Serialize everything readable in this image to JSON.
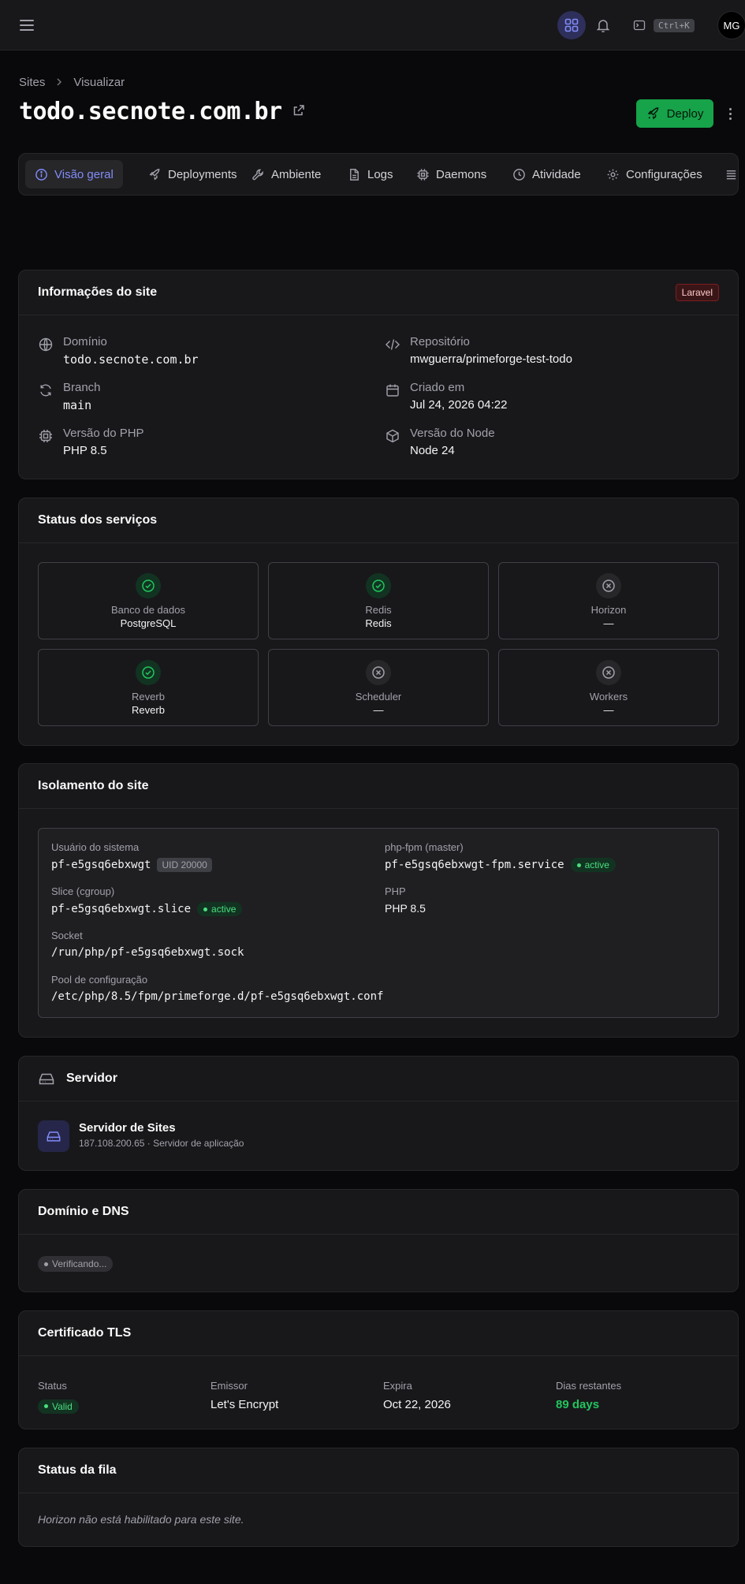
{
  "topbar": {
    "shortcut": "Ctrl+K",
    "avatar_initials": "MG",
    "accent": "#818cf8"
  },
  "breadcrumb": {
    "root": "Sites",
    "current": "Visualizar"
  },
  "page": {
    "title": "todo.secnote.com.br",
    "deploy_label": "Deploy"
  },
  "tabs": [
    {
      "label": "Visão geral",
      "icon": "info-icon",
      "active": true
    },
    {
      "label": "Deployments",
      "icon": "rocket-icon"
    },
    {
      "label": "Ambiente",
      "icon": "wrench-icon"
    },
    {
      "label": "Logs",
      "icon": "file-icon"
    },
    {
      "label": "Daemons",
      "icon": "cpu-icon"
    },
    {
      "label": "Atividade",
      "icon": "clock-icon"
    },
    {
      "label": "Configurações",
      "icon": "gear-icon"
    }
  ],
  "site_info": {
    "title": "Informações do site",
    "framework_badge": "Laravel",
    "domain_label": "Domínio",
    "domain": "todo.secnote.com.br",
    "repo_label": "Repositório",
    "repo": "mwguerra/primeforge-test-todo",
    "branch_label": "Branch",
    "branch": "main",
    "created_label": "Criado em",
    "created": "Jul 24, 2026 04:22",
    "php_label": "Versão do PHP",
    "php": "PHP 8.5",
    "node_label": "Versão do Node",
    "node": "Node 24"
  },
  "services": {
    "title": "Status dos serviços",
    "items": [
      {
        "name": "Banco de dados",
        "value": "PostgreSQL",
        "status": "ok"
      },
      {
        "name": "Redis",
        "value": "Redis",
        "status": "ok"
      },
      {
        "name": "Horizon",
        "value": "—",
        "status": "off"
      },
      {
        "name": "Reverb",
        "value": "Reverb",
        "status": "ok"
      },
      {
        "name": "Scheduler",
        "value": "—",
        "status": "off"
      },
      {
        "name": "Workers",
        "value": "—",
        "status": "off"
      }
    ]
  },
  "isolation": {
    "title": "Isolamento do site",
    "user_label": "Usuário do sistema",
    "user": "pf-e5gsq6ebxwgt",
    "uid": "UID 20000",
    "fpm_label": "php-fpm (master)",
    "fpm": "pf-e5gsq6ebxwgt-fpm.service",
    "fpm_status": "active",
    "slice_label": "Slice (cgroup)",
    "slice": "pf-e5gsq6ebxwgt.slice",
    "slice_status": "active",
    "php_label": "PHP",
    "php": "PHP 8.5",
    "socket_label": "Socket",
    "socket": "/run/php/pf-e5gsq6ebxwgt.sock",
    "pool_label": "Pool de configuração",
    "pool": "/etc/php/8.5/fpm/primeforge.d/pf-e5gsq6ebxwgt.conf"
  },
  "server": {
    "title": "Servidor",
    "name": "Servidor de Sites",
    "meta": "187.108.200.65 · Servidor de aplicação"
  },
  "dns": {
    "title": "Domínio e DNS",
    "status": "Verificando..."
  },
  "tls": {
    "title": "Certificado TLS",
    "status_label": "Status",
    "status": "Valid",
    "issuer_label": "Emissor",
    "issuer": "Let's Encrypt",
    "expires_label": "Expira",
    "expires": "Oct 22, 2026",
    "days_label": "Dias restantes",
    "days": "89 days",
    "days_color": "#22c55e"
  },
  "queue": {
    "title": "Status da fila",
    "message": "Horizon não está habilitado para este site."
  }
}
